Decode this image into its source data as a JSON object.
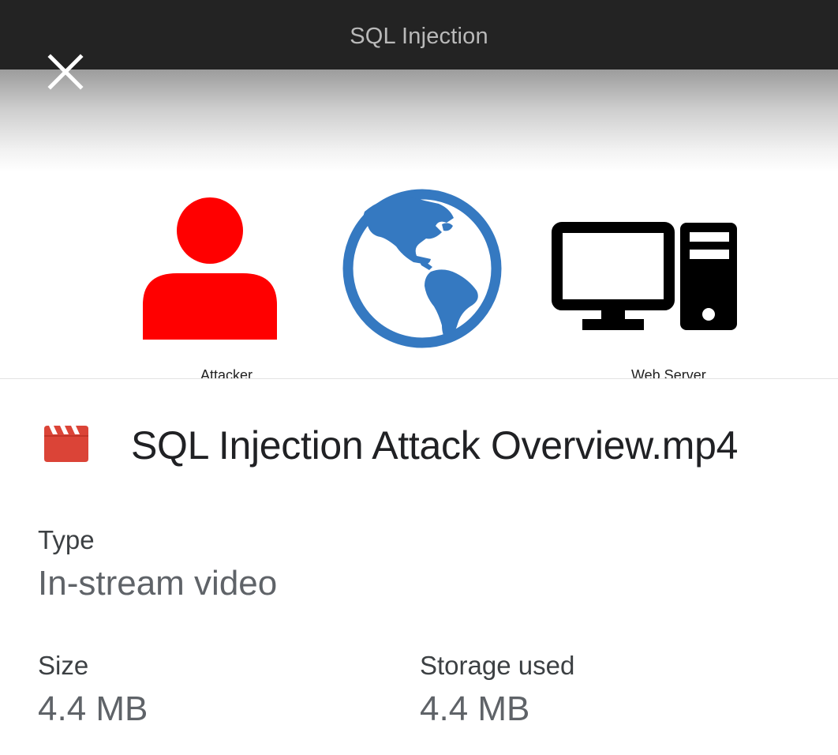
{
  "preview": {
    "title": "SQL Injection",
    "close_icon": "close-icon",
    "diagram": {
      "attacker_label": "Attacker",
      "server_label": "Web Server",
      "attacker_color": "#ff0000",
      "globe_color": "#3579c1",
      "server_color": "#000000"
    }
  },
  "file": {
    "icon": "video-clapperboard-icon",
    "icon_color": "#db4437",
    "name": "SQL Injection Attack Overview.mp4"
  },
  "details": {
    "type_label": "Type",
    "type_value": "In-stream video",
    "size_label": "Size",
    "size_value": "4.4 MB",
    "storage_label": "Storage used",
    "storage_value": "4.4 MB"
  }
}
